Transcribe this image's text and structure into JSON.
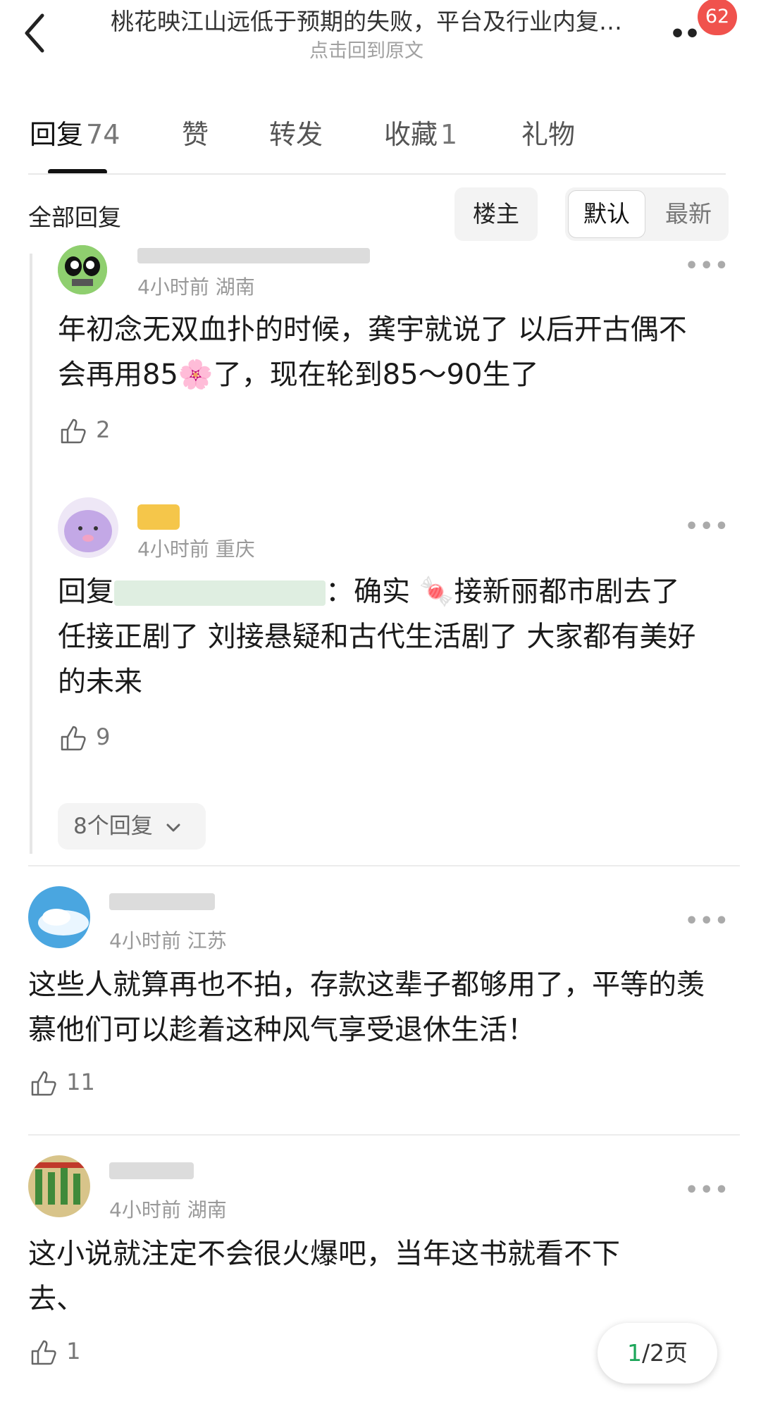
{
  "header": {
    "title": "桃花映江山远低于预期的失败，平台及行业内复…",
    "subtitle": "点击回到原文",
    "badge_count": "62"
  },
  "tabs": [
    {
      "label": "回复",
      "count": "74",
      "active": true
    },
    {
      "label": "赞",
      "count": ""
    },
    {
      "label": "转发",
      "count": ""
    },
    {
      "label": "收藏",
      "count": "1"
    },
    {
      "label": "礼物",
      "count": ""
    }
  ],
  "filter": {
    "all_label": "全部回复",
    "op_label": "楼主",
    "sort_default": "默认",
    "sort_latest": "最新"
  },
  "comments": [
    {
      "meta": "4小时前 湖南",
      "content": "年初念无双血扑的时候，龚宇就说了 以后开古偶不会再用85🌸了，现在轮到85～90生了",
      "likes": "2"
    },
    {
      "meta": "4小时前 重庆",
      "reply_prefix": "回复",
      "content": "：确实 🍬接新丽都市剧去了 任接正剧了 刘接悬疑和古代生活剧了 大家都有美好的未来",
      "likes": "9"
    },
    {
      "meta": "4小时前 江苏",
      "content": "这些人就算再也不拍，存款这辈子都够用了，平等的羡慕他们可以趁着这种风气享受退休生活！",
      "likes": "11"
    },
    {
      "meta": "4小时前 湖南",
      "content": "这小说就注定不会很火爆吧，当年这书就看不下去、",
      "likes": "1"
    }
  ],
  "expand_replies": "8个回复",
  "pagination": {
    "current": "1",
    "rest": "/2页"
  }
}
